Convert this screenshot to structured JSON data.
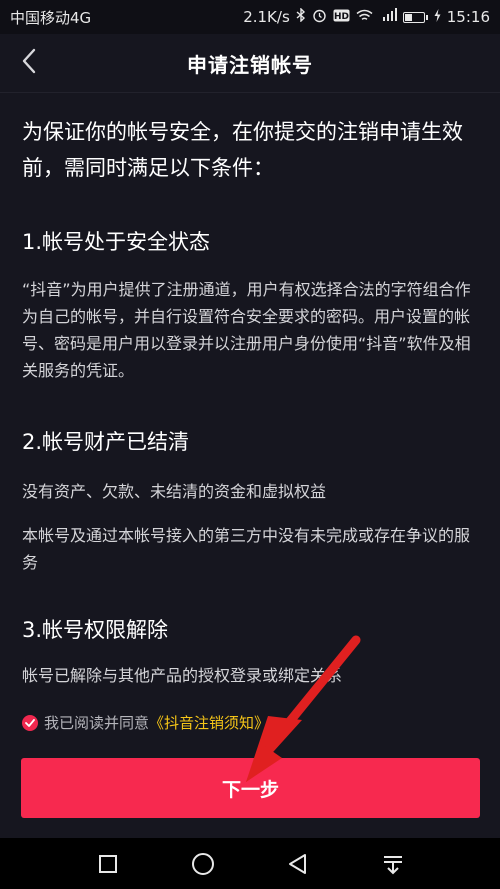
{
  "status_bar": {
    "carrier": "中国移动4G",
    "speed": "2.1K/s",
    "battery_level": "40",
    "battery_fraction": 0.4,
    "time": "15:16",
    "icons": [
      "bluetooth-icon",
      "alarm-icon",
      "hd-icon",
      "wifi-icon",
      "signal-4g-icon",
      "battery-icon",
      "charging-icon"
    ]
  },
  "header": {
    "title": "申请注销帐号",
    "back_icon": "chevron-left-icon"
  },
  "intro": "为保证你的帐号安全，在你提交的注销申请生效前，需同时满足以下条件：",
  "sections": [
    {
      "title": "1.帐号处于安全状态",
      "paragraphs": [
        "“抖音”为用户提供了注册通道，用户有权选择合法的字符组合作为自己的帐号，并自行设置符合安全要求的密码。用户设置的帐号、密码是用户用以登录并以注册用户身份使用“抖音”软件及相关服务的凭证。"
      ]
    },
    {
      "title": "2.帐号财产已结清",
      "paragraphs": [
        "没有资产、欠款、未结清的资金和虚拟权益",
        "本帐号及通过本帐号接入的第三方中没有未完成或存在争议的服务"
      ]
    },
    {
      "title": "3.帐号权限解除",
      "paragraphs": [
        "帐号已解除与其他产品的授权登录或绑定关系"
      ]
    }
  ],
  "agreement": {
    "checked": true,
    "prefix": "我已阅读并同意",
    "link": "《抖音注销须知》"
  },
  "next_button": {
    "label": "下一步"
  },
  "nav_bar": {
    "icons": [
      "recent-apps-icon",
      "home-icon",
      "back-icon",
      "notification-pull-icon"
    ]
  },
  "colors": {
    "background": "#16161f",
    "accent": "#f7294f",
    "link": "#f5c518",
    "body_text": "#d4d4d8"
  }
}
